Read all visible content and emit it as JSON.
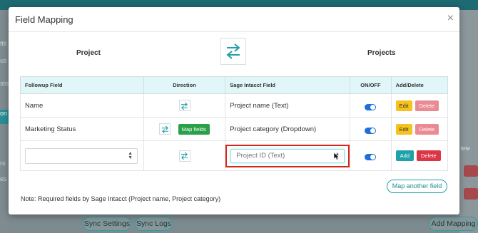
{
  "modal": {
    "title": "Field Mapping",
    "close_symbol": "×",
    "left_system": "Project",
    "right_system": "Projects"
  },
  "table": {
    "headers": [
      "Followup Field",
      "Direction",
      "Sage Intacct Field",
      "ON/OFF",
      "Add/Delete"
    ],
    "rows": [
      {
        "followup": "Name",
        "sage": "Project name (Text)",
        "edit": "Edit",
        "delete": "Delete"
      },
      {
        "followup": "Marketing Status",
        "map_button": "Map fields",
        "sage": "Project category (Dropdown)",
        "edit": "Edit",
        "delete": "Delete"
      },
      {
        "followup": "",
        "sage": "Project ID (Text)",
        "add": "Add",
        "delete": "Delete"
      }
    ]
  },
  "note": "Note: Required fields by Sage Intacct (Project name, Project category)",
  "map_another_label": "Map another field",
  "background": {
    "sync_settings": "Sync Settings",
    "sync_logs": "Sync Logs",
    "add_mapping": "Add Mapping",
    "right_label": "lete",
    "left_fragments": [
      "ttii",
      "us",
      "sto",
      "on",
      "rs",
      "es"
    ]
  },
  "colors": {
    "accent": "#1ea1a9",
    "header_bg": "#e1f6f9",
    "edit": "#f6c21d",
    "delete": "#dc3545",
    "map_fields": "#2aa149",
    "highlight": "#d9261c",
    "toggle": "#1e6fd9"
  },
  "icons": {
    "swap": "swap-arrows-icon",
    "select": "select-arrows-icon",
    "cursor": "mouse-cursor-icon"
  }
}
